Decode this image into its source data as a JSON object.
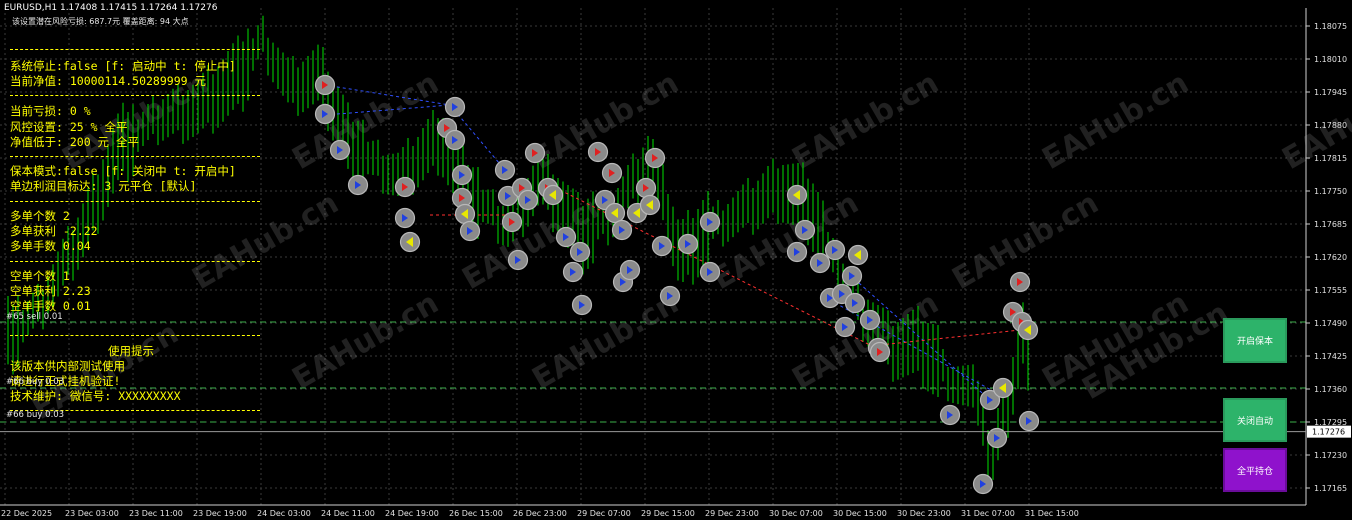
{
  "header": {
    "symbol_line": "EURUSD,H1  1.17408 1.17415 1.17264 1.17276",
    "risk_line": "该设置潜在风险亏损: 687.7元   覆盖距离: 94 大点"
  },
  "panel": {
    "lines": [
      "系统停止:false [f: 启动中 t: 停止中]",
      "当前净值: 10000114.50289999 元",
      "当前亏损: 0 %",
      "风控设置: 25 % 全平",
      "净值低于: 200 元 全平",
      "保本模式:false [f: 关闭中 t: 开启中]",
      "单边利润目标达: 3 元平仓 [默认]",
      "多单个数 2",
      "多单获利 -2.22",
      "多单手数 0.04",
      "空单个数 1",
      "空单获利 2.23",
      "空单手数 0.01",
      "使用提示",
      "该版本供内部测试使用",
      "请进行正式挂机验证!",
      "技术维护: 微信号: XXXXXXXXX"
    ]
  },
  "trade_tags": {
    "sell_tag": "#65 sell 0.01",
    "buy_tag_1": "#66 buy 0.03",
    "buy_tag_2": "#66 buy 0.03"
  },
  "buttons": {
    "enable_breakeven": "开启保本",
    "disable_auto": "关闭自动",
    "close_all": "全平持仓"
  },
  "price_axis": {
    "labels": [
      "1.18075",
      "1.18010",
      "1.17945",
      "1.17880",
      "1.17815",
      "1.17750",
      "1.17685",
      "1.17620",
      "1.17555",
      "1.17490",
      "1.17425",
      "1.17360",
      "1.17295",
      "1.17230",
      "1.17165"
    ],
    "current_price": "1.17276"
  },
  "time_axis": {
    "labels": [
      "22 Dec 2025",
      "23 Dec 03:00",
      "23 Dec 11:00",
      "23 Dec 19:00",
      "24 Dec 03:00",
      "24 Dec 11:00",
      "24 Dec 19:00",
      "26 Dec 15:00",
      "26 Dec 23:00",
      "29 Dec 07:00",
      "29 Dec 15:00",
      "29 Dec 23:00",
      "30 Dec 07:00",
      "30 Dec 15:00",
      "30 Dec 23:00",
      "31 Dec 07:00",
      "31 Dec 15:00"
    ]
  },
  "watermark": "EAHub.cn",
  "colors": {
    "background": "#000000",
    "candles": "#00e000",
    "panel_text": "#ffff00",
    "grid": "#3a3a3a",
    "button_green": "#2db36a",
    "button_purple": "#8f12cc"
  }
}
